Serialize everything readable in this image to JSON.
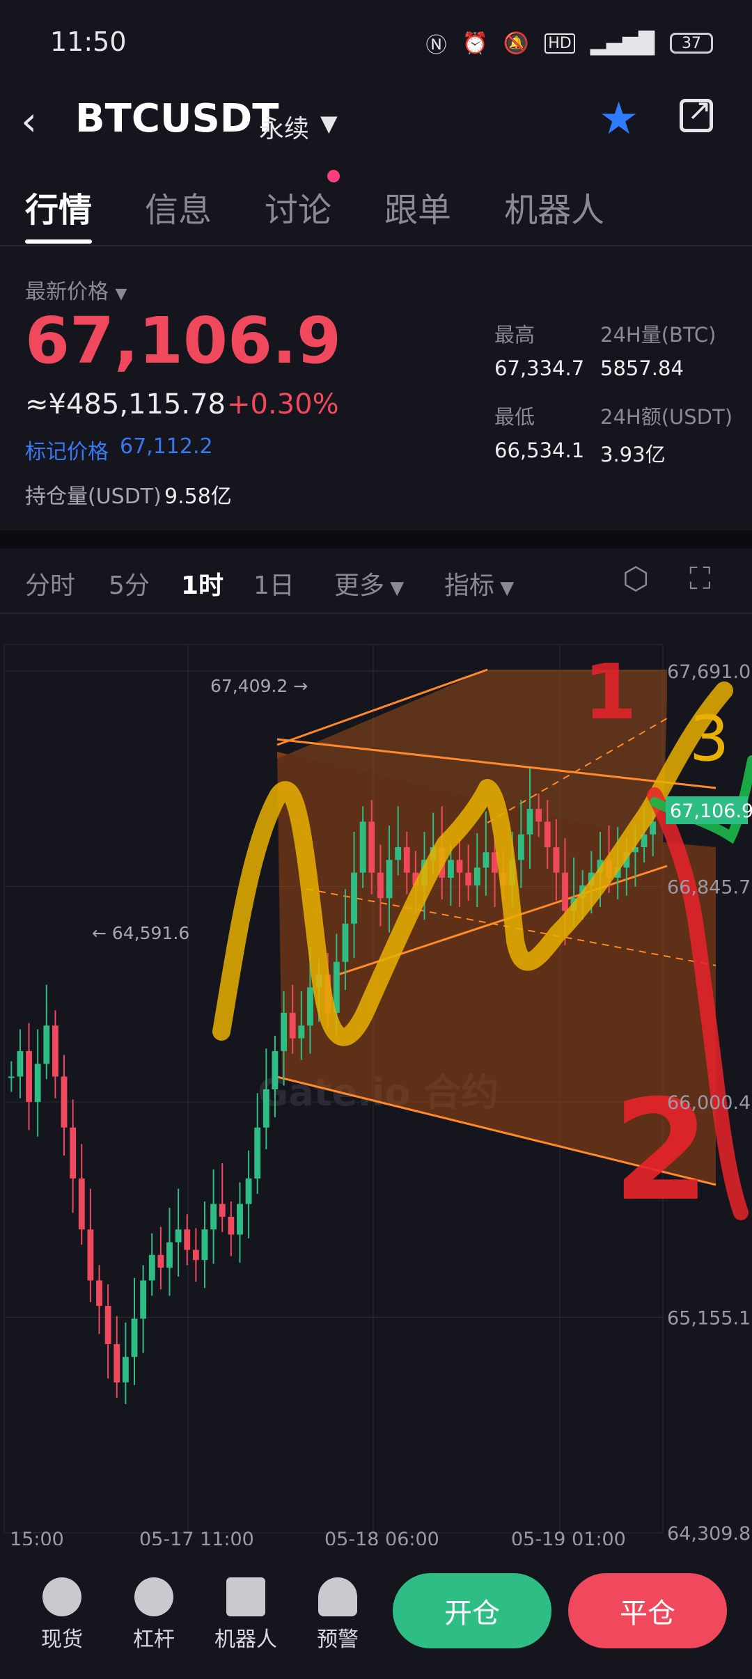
{
  "status_bar": {
    "time": "11:50",
    "battery": "37",
    "icons": [
      "nfc-icon",
      "alarm-icon",
      "mute-icon",
      "hd-icon",
      "signal-5g-icon"
    ]
  },
  "header": {
    "symbol": "BTCUSDT",
    "contract_type": "永续",
    "favorite_color": "#2f7bff"
  },
  "tabs": [
    {
      "label": "行情",
      "active": true
    },
    {
      "label": "信息",
      "active": false
    },
    {
      "label": "讨论",
      "active": false,
      "badge": true
    },
    {
      "label": "跟单",
      "active": false
    },
    {
      "label": "机器人",
      "active": false
    }
  ],
  "price": {
    "label": "最新价格",
    "last": "67,106.9",
    "cny": "≈¥485,115.78",
    "change": "+0.30%",
    "mark_label": "标记价格",
    "mark_value": "67,112.2",
    "oi_label": "持仓量(USDT)",
    "oi_value": "9.58亿"
  },
  "stats": {
    "high_label": "最高",
    "high": "67,334.7",
    "vol_btc_label": "24H量(BTC)",
    "vol_btc": "5857.84",
    "low_label": "最低",
    "low": "66,534.1",
    "vol_usdt_label": "24H额(USDT)",
    "vol_usdt": "3.93亿"
  },
  "timeframes": {
    "t1": "分时",
    "t2": "5分",
    "t3": "1时",
    "t4": "1日",
    "more": "更多",
    "indicators": "指标"
  },
  "chart_data": {
    "type": "candlestick",
    "y_ticks": [
      "67,691.0",
      "66,845.7",
      "66,000.4",
      "65,155.1",
      "64,309.8"
    ],
    "x_ticks": [
      "15:00",
      "05-17 11:00",
      "05-18 06:00",
      "05-19 01:00"
    ],
    "ylim": [
      64309.8,
      67691.0
    ],
    "current_price_label": "67,106.9",
    "high_marker": "67,409.2 →",
    "low_marker": "← 64,591.6",
    "watermark": "Gate.io 合约",
    "annotation_numbers": [
      "1",
      "2",
      "3"
    ],
    "colors": {
      "up": "#2ebd85",
      "down": "#f0485c",
      "channel": "#ff8a2a",
      "zigzag": "#e8b000"
    }
  },
  "bottom_nav": {
    "spot": "现货",
    "margin": "杠杆",
    "bot": "机器人",
    "alert": "预警",
    "open": "开仓",
    "close": "平仓",
    "open_color": "#2ebd85",
    "close_color": "#f0485c"
  }
}
